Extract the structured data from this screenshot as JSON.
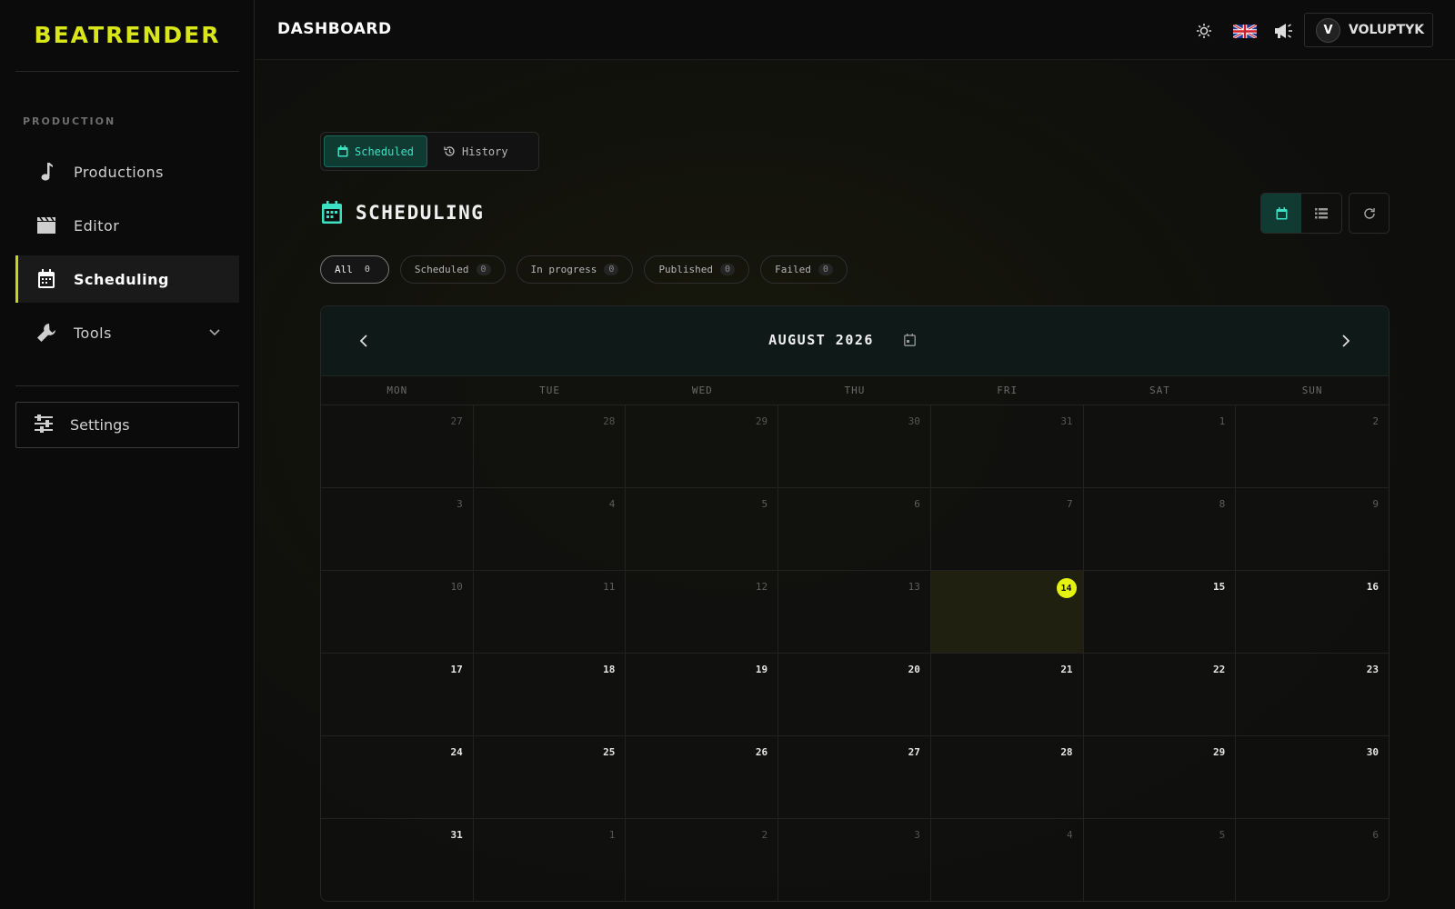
{
  "app": {
    "logo": "BEATRENDER"
  },
  "sidebar": {
    "section_label": "PRODUCTION",
    "items": [
      {
        "label": "Productions",
        "icon": "music-note-icon"
      },
      {
        "label": "Editor",
        "icon": "clapperboard-icon"
      },
      {
        "label": "Scheduling",
        "icon": "calendar-icon",
        "active": true
      },
      {
        "label": "Tools",
        "icon": "wrench-icon",
        "expandable": true
      }
    ],
    "settings_label": "Settings"
  },
  "header": {
    "title": "DASHBOARD",
    "icons": [
      "sun-icon",
      "uk-flag-icon",
      "megaphone-icon"
    ],
    "user": {
      "initial": "V",
      "name": "VOLUPTYK"
    }
  },
  "main": {
    "tabs": [
      {
        "label": "Scheduled",
        "active": true
      },
      {
        "label": "History"
      }
    ],
    "title": "SCHEDULING",
    "filters": [
      {
        "label": "All",
        "count": "0",
        "active": true
      },
      {
        "label": "Scheduled",
        "count": "0"
      },
      {
        "label": "In progress",
        "count": "0"
      },
      {
        "label": "Published",
        "count": "0"
      },
      {
        "label": "Failed",
        "count": "0"
      }
    ]
  },
  "calendar": {
    "month_label": "AUGUST 2026",
    "weekdays": [
      "MON",
      "TUE",
      "WED",
      "THU",
      "FRI",
      "SAT",
      "SUN"
    ],
    "today": "14",
    "days": [
      {
        "d": "27",
        "s": "other"
      },
      {
        "d": "28",
        "s": "other"
      },
      {
        "d": "29",
        "s": "other"
      },
      {
        "d": "30",
        "s": "other"
      },
      {
        "d": "31",
        "s": "other"
      },
      {
        "d": "1",
        "s": "past"
      },
      {
        "d": "2",
        "s": "past"
      },
      {
        "d": "3",
        "s": "past"
      },
      {
        "d": "4",
        "s": "past"
      },
      {
        "d": "5",
        "s": "past"
      },
      {
        "d": "6",
        "s": "past"
      },
      {
        "d": "7",
        "s": "past"
      },
      {
        "d": "8",
        "s": "past"
      },
      {
        "d": "9",
        "s": "past"
      },
      {
        "d": "10",
        "s": "past"
      },
      {
        "d": "11",
        "s": "past"
      },
      {
        "d": "12",
        "s": "past"
      },
      {
        "d": "13",
        "s": "past"
      },
      {
        "d": "14",
        "s": "today"
      },
      {
        "d": "15",
        "s": "current"
      },
      {
        "d": "16",
        "s": "current"
      },
      {
        "d": "17",
        "s": "current"
      },
      {
        "d": "18",
        "s": "current"
      },
      {
        "d": "19",
        "s": "current"
      },
      {
        "d": "20",
        "s": "current"
      },
      {
        "d": "21",
        "s": "current"
      },
      {
        "d": "22",
        "s": "current"
      },
      {
        "d": "23",
        "s": "current"
      },
      {
        "d": "24",
        "s": "current"
      },
      {
        "d": "25",
        "s": "current"
      },
      {
        "d": "26",
        "s": "current"
      },
      {
        "d": "27",
        "s": "current"
      },
      {
        "d": "28",
        "s": "current"
      },
      {
        "d": "29",
        "s": "current"
      },
      {
        "d": "30",
        "s": "current"
      },
      {
        "d": "31",
        "s": "current"
      },
      {
        "d": "1",
        "s": "other"
      },
      {
        "d": "2",
        "s": "other"
      },
      {
        "d": "3",
        "s": "other"
      },
      {
        "d": "4",
        "s": "other"
      },
      {
        "d": "5",
        "s": "other"
      },
      {
        "d": "6",
        "s": "other"
      }
    ]
  },
  "colors": {
    "accent": "#d9e61a",
    "teal": "#3ee0c4",
    "today": "#e5f20d"
  }
}
